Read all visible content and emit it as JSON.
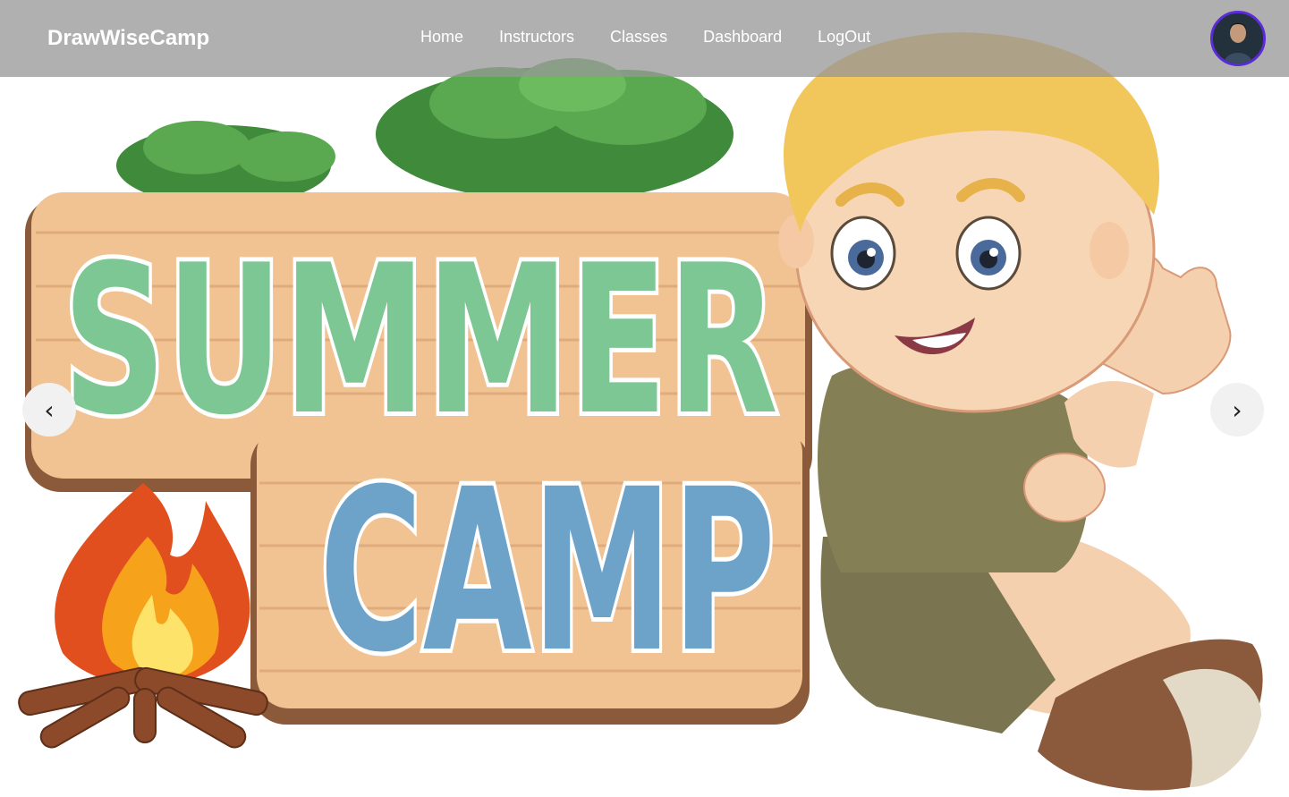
{
  "app": {
    "brand": "DrawWiseCamp"
  },
  "nav": {
    "items": [
      {
        "label": "Home"
      },
      {
        "label": "Instructors"
      },
      {
        "label": "Classes"
      },
      {
        "label": "Dashboard"
      },
      {
        "label": "LogOut"
      }
    ]
  },
  "user": {
    "avatar_icon": "user-avatar"
  },
  "carousel": {
    "prev_glyph": "‹",
    "next_glyph": "›",
    "slide": {
      "sign_line1": "SUMMER",
      "sign_line2": "CAMP"
    }
  },
  "colors": {
    "nav_bg": "#969696",
    "avatar_ring": "#5b2bd9",
    "summer_green": "#7cc794",
    "camp_blue": "#6ea3c9",
    "wood": "#e9b98a"
  }
}
